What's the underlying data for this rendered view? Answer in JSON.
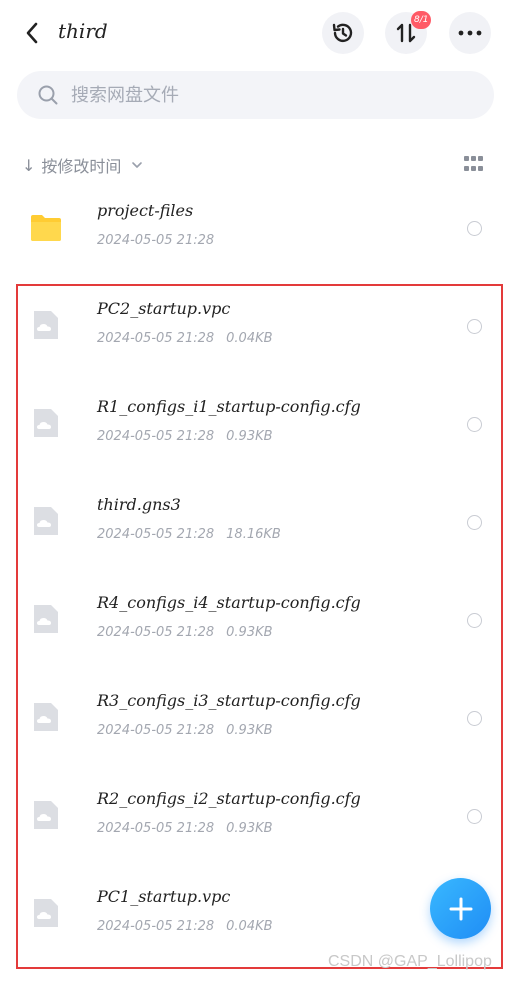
{
  "header": {
    "title": "third",
    "transfer_badge": "8/1"
  },
  "search": {
    "placeholder": "搜索网盘文件"
  },
  "sort": {
    "label": "按修改时间"
  },
  "files": [
    {
      "name": "project-files",
      "date": "2024-05-05 21:28",
      "size": "",
      "type": "folder"
    },
    {
      "name": "PC2_startup.vpc",
      "date": "2024-05-05 21:28",
      "size": "0.04KB",
      "type": "file"
    },
    {
      "name": "R1_configs_i1_startup-config.cfg",
      "date": "2024-05-05 21:28",
      "size": "0.93KB",
      "type": "file"
    },
    {
      "name": "third.gns3",
      "date": "2024-05-05 21:28",
      "size": "18.16KB",
      "type": "file"
    },
    {
      "name": "R4_configs_i4_startup-config.cfg",
      "date": "2024-05-05 21:28",
      "size": "0.93KB",
      "type": "file"
    },
    {
      "name": "R3_configs_i3_startup-config.cfg",
      "date": "2024-05-05 21:28",
      "size": "0.93KB",
      "type": "file"
    },
    {
      "name": "R2_configs_i2_startup-config.cfg",
      "date": "2024-05-05 21:28",
      "size": "0.93KB",
      "type": "file"
    },
    {
      "name": "PC1_startup.vpc",
      "date": "2024-05-05 21:28",
      "size": "0.04KB",
      "type": "file"
    }
  ],
  "watermark": "CSDN @GAP_Lollipop",
  "colors": {
    "accent": "#1f8df5",
    "folder": "#ffcc33",
    "highlight_border": "#e33a3a",
    "badge": "#ff5a66"
  }
}
